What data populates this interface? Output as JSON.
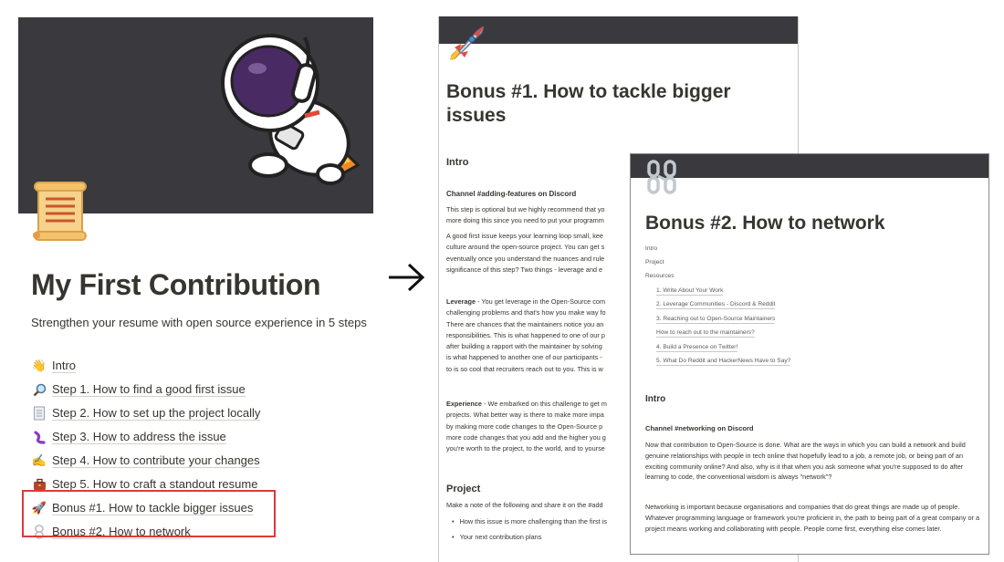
{
  "left_page": {
    "title": "My First Contribution",
    "subtitle": "Strengthen your resume with open source experience in 5 steps",
    "toc": [
      {
        "icon": "waving-hand-icon",
        "label": "Intro"
      },
      {
        "icon": "magnifier-icon",
        "label": "Step 1. How to find a good first issue"
      },
      {
        "icon": "document-icon",
        "label": "Step 2. How to set up the project locally"
      },
      {
        "icon": "worm-icon",
        "label": "Step 3. How to address the issue"
      },
      {
        "icon": "writing-hand-icon",
        "label": "Step 4. How to contribute your changes"
      },
      {
        "icon": "briefcase-icon",
        "label": "Step 5. How to craft a standout resume"
      },
      {
        "icon": "rocket-icon",
        "label": "Bonus #1. How to tackle bigger issues"
      },
      {
        "icon": "chain-icon",
        "label": "Bonus #2. How to network"
      }
    ],
    "highlight_color": "#e0383a"
  },
  "doc1": {
    "title": "Bonus #1. How to tackle bigger issues",
    "intro_heading": "Intro",
    "channel_heading": "Channel #adding-features on Discord",
    "para1": [
      "This step is optional but we highly recommend that yo",
      "more doing this since you need to put your programm"
    ],
    "para2": [
      "A good first issue keeps your learning loop small, kee",
      "culture around the open-source project. You can get s",
      "eventually once you understand the nuances and rule",
      "significance of this step? Two things - leverage and e"
    ],
    "leverage_label": "Leverage",
    "para3_first": " - You get leverage in the Open-Source com",
    "para3": [
      "challenging problems and that's how you make way fo",
      "There are chances that the maintainers notice you an",
      "responsibilities. This is what happened to one of our p",
      "after building a rapport with the maintainer by solving",
      "is what happened to another one of our participants -",
      "to is so cool that recruiters reach out to you. This is w"
    ],
    "experience_label": "Experience",
    "para4_first": " - We embarked on this challenge to get m",
    "para4": [
      "projects. What better way is there to make more impa",
      "by making more code changes to the Open-Source p",
      "more code changes that you add and the higher you g",
      "you're worth to the project, to the world, and to yourse"
    ],
    "project_heading": "Project",
    "project_line": "Make a note of the following and share it on the #add",
    "bullets": [
      "How this issue is more challenging than the first is",
      "Your next contribution plans"
    ]
  },
  "doc2": {
    "title": "Bonus #2. How to network",
    "nav": [
      "Intro",
      "Project",
      "Resources"
    ],
    "sub_nav": [
      "1. Write About Your Work",
      "2. Leverage Communities - Discord & Reddit",
      "3. Reaching out to Open-Source Maintainers",
      "How to reach out to the maintainers?",
      "4. Build a Presence on Twitter!",
      "5. What Do Reddit and HackerNews Have to Say?"
    ],
    "intro_heading": "Intro",
    "channel_heading": "Channel #networking on Discord",
    "para1": "Now that contribution to Open-Source is done. What are the ways in which you can build a network and build genuine relationships with people in tech online that hopefully lead to a job, a remote job, or being part of an exciting community online? And also, why is it that when you ask someone what you're supposed to do after learning to code, the conventional wisdom is always \"network\"?",
    "para2": "Networking is important because organisations and companies that do great things are made up of people. Whatever programming language or framework you're proficient in, the path to being part of a great company or a project means working and collaborating with people. People come first, everything else comes later."
  }
}
